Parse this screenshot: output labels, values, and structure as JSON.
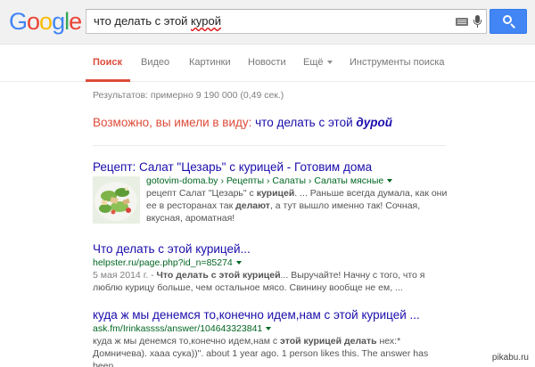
{
  "logo": {
    "letters": [
      "G",
      "o",
      "o",
      "g",
      "l",
      "e"
    ],
    "colors": [
      "#4285f4",
      "#ea4335",
      "#fbbc05",
      "#4285f4",
      "#34a853",
      "#ea4335"
    ]
  },
  "search": {
    "query_prefix": "что делать с этой ",
    "query_misspelled": "курой"
  },
  "tabs": [
    {
      "label": "Поиск",
      "active": true
    },
    {
      "label": "Видео"
    },
    {
      "label": "Картинки"
    },
    {
      "label": "Новости"
    },
    {
      "label": "Ещё"
    },
    {
      "label": "Инструменты поиска"
    }
  ],
  "stats": "Результатов: примерно 9 190 000 (0,49 сек.)",
  "did_you_mean": {
    "label": "Возможно, вы имели в виду:",
    "text": "что делать с этой",
    "bold": "дурой"
  },
  "results": [
    {
      "title": "Рецепт: Салат \"Цезарь\" с курицей - Готовим дома",
      "url": "gotovim-doma.by › Рецепты › Салаты › Салаты мясные",
      "snippet_parts": [
        "рецепт Салат \"Цезарь\" с ",
        "курицей",
        ". ... Раньше всегда думала, как они ее в ресторанах так ",
        "делают",
        ", а тут вышло именно так! Сочная, вкусная, ароматная!"
      ]
    },
    {
      "title": "Что делать с этой курицей...",
      "url": "helpster.ru/page.php?id_n=85274",
      "date": "5 мая 2014 г. -",
      "snippet_parts": [
        " ",
        "Что делать с этой курицей",
        "... Выручайте! Начну с того, что я люблю курицу больше, чем остальное мясо. Свинину вообще не ем, ..."
      ]
    },
    {
      "title": "куда ж мы денемся то,конечно идем,нам с этой курицей ...",
      "url": "ask.fm/Irinkassss/answer/104643323841",
      "snippet_parts": [
        "куда ж мы денемся то,конечно идем,нам с ",
        "этой курицей делать",
        " нех:* Домничева). хааа сука))\". about 1 year ago. 1 person likes this. The answer has been ..."
      ]
    }
  ],
  "watermark": "pikabu.ru"
}
